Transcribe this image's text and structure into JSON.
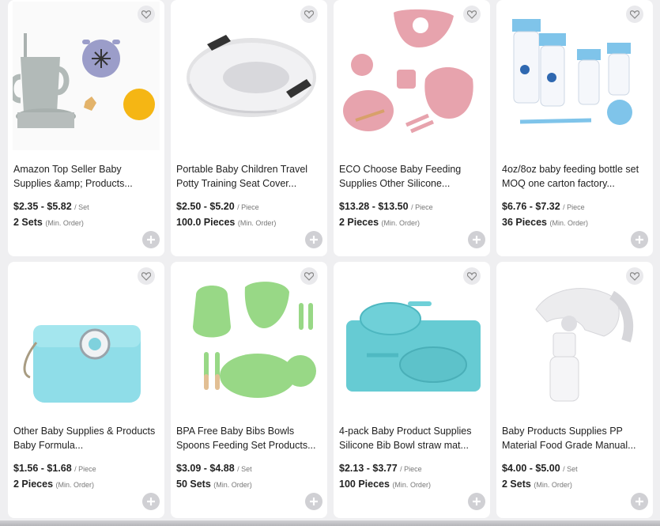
{
  "products": [
    {
      "title": "Amazon Top Seller Baby Supplies &amp; Products...",
      "price": "$2.35 - $5.82",
      "unit": "/ Set",
      "moq": "2 Sets",
      "moq_note": "(Min. Order)",
      "image": "sippy-cup-set-image"
    },
    {
      "title": "Portable Baby Children Travel Potty Training Seat Cover...",
      "price": "$2.50 - $5.20",
      "unit": "/ Piece",
      "moq": "100.0 Pieces",
      "moq_note": "(Min. Order)",
      "image": "potty-seat-image"
    },
    {
      "title": "ECO Choose Baby Feeding Supplies Other Silicone...",
      "price": "$13.28 - $13.50",
      "unit": "/ Piece",
      "moq": "2 Pieces",
      "moq_note": "(Min. Order)",
      "image": "pink-feeding-set-image"
    },
    {
      "title": "4oz/8oz baby feeding bottle set MOQ one carton factory...",
      "price": "$6.76 - $7.32",
      "unit": "/ Piece",
      "moq": "36 Pieces",
      "moq_note": "(Min. Order)",
      "image": "bottle-set-image"
    },
    {
      "title": "Other Baby Supplies & Products Baby Formula...",
      "price": "$1.56 - $1.68",
      "unit": "/ Piece",
      "moq": "2 Pieces",
      "moq_note": "(Min. Order)",
      "image": "formula-container-image"
    },
    {
      "title": "BPA Free Baby Bibs Bowls Spoons Feeding Set Products...",
      "price": "$3.09 - $4.88",
      "unit": "/ Set",
      "moq": "50 Sets",
      "moq_note": "(Min. Order)",
      "image": "green-feeding-set-image"
    },
    {
      "title": "4-pack Baby Product Supplies Silicone Bib Bowl straw mat...",
      "price": "$2.13 - $3.77",
      "unit": "/ Piece",
      "moq": "100 Pieces",
      "moq_note": "(Min. Order)",
      "image": "blue-placemat-image"
    },
    {
      "title": "Baby Products Supplies PP Material Food Grade Manual...",
      "price": "$4.00 - $5.00",
      "unit": "/ Set",
      "moq": "2 Sets",
      "moq_note": "(Min. Order)",
      "image": "breast-pump-image"
    }
  ],
  "icons": {
    "favorite": "heart-icon",
    "add": "plus-icon"
  },
  "colors": {
    "card_bg": "#ffffff",
    "page_bg": "#efeff1",
    "icon_bg": "#d0d0d4"
  }
}
